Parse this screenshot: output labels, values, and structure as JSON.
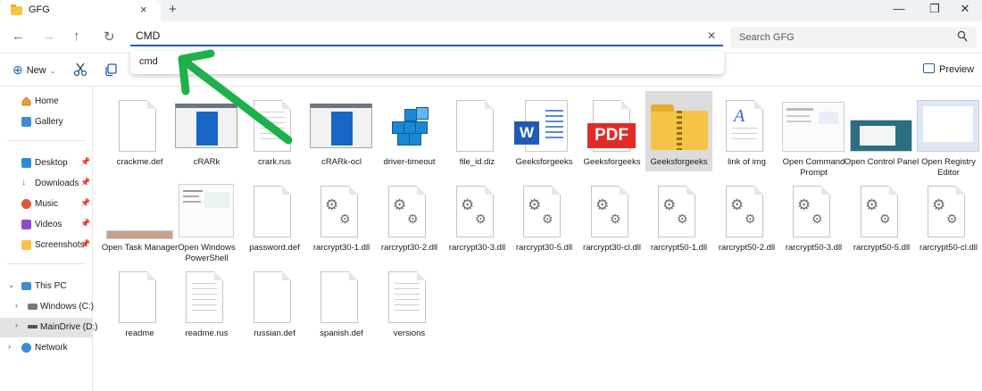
{
  "tab": {
    "title": "GFG",
    "close_icon": "×",
    "new_icon": "+"
  },
  "window": {
    "minimize": "—",
    "maximize": "❐",
    "close": "✕"
  },
  "nav": {
    "back": "←",
    "forward": "→",
    "up": "↑",
    "refresh": "↻"
  },
  "address": {
    "value": "CMD",
    "clear_icon": "✕"
  },
  "search": {
    "placeholder": "Search GFG"
  },
  "autocomplete": {
    "suggestion": "cmd"
  },
  "toolbar": {
    "new_label": "New",
    "preview_label": "Preview"
  },
  "sidebar": {
    "home": "Home",
    "gallery": "Gallery",
    "desktop": "Desktop",
    "downloads": "Downloads",
    "music": "Music",
    "videos": "Videos",
    "screenshots": "Screenshots",
    "this_pc": "This PC",
    "windows_c": "Windows (C:)",
    "maindrive_d": "MainDrive (D:)",
    "network": "Network"
  },
  "files": {
    "f0": "crackme.def",
    "f1": "cRARk",
    "f2": "crark.rus",
    "f3": "cRARk-ocl",
    "f4": "driver-timeout",
    "f5": "file_id.diz",
    "f6": "Geeksforgeeks",
    "f7": "Geeksforgeeks",
    "f8": "Geeksforgeeks",
    "f9": "link of img",
    "f10": "Open Command Prompt",
    "f11": "Open Control Panel",
    "f12": "Open Registry Editor",
    "f13": "Open Task Manager",
    "f14": "Open Windows PowerShell",
    "f15": "password.def",
    "f16": "rarcrypt30-1.dll",
    "f17": "rarcrypt30-2.dll",
    "f18": "rarcrypt30-3.dll",
    "f19": "rarcrypt30-5.dll",
    "f20": "rarcrypt30-cl.dll",
    "f21": "rarcrypt50-1.dll",
    "f22": "rarcrypt50-2.dll",
    "f23": "rarcrypt50-3.dll",
    "f24": "rarcrypt50-5.dll",
    "f25": "rarcrypt50-cl.dll",
    "f26": "readme",
    "f27": "readme.rus",
    "f28": "russian.def",
    "f29": "spanish.def",
    "f30": "versions"
  },
  "icons": {
    "pdf_text": "PDF",
    "word_letter": "W"
  },
  "colors": {
    "accent": "#1a5fb4",
    "annotation_arrow": "#1db14b",
    "selection": "#dcdcdc"
  }
}
